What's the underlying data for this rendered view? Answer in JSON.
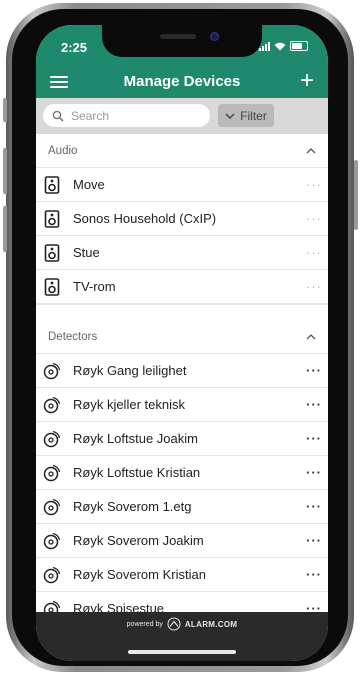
{
  "status_bar": {
    "time": "2:25"
  },
  "app_bar": {
    "title": "Manage Devices",
    "menu_icon": "hamburger-menu-icon",
    "add_icon": "plus-icon"
  },
  "search": {
    "placeholder": "Search",
    "filter_label": "Filter"
  },
  "sections": [
    {
      "title": "Audio",
      "icon": "speaker-icon",
      "items": [
        "Move",
        "Sonos Household (CxIP)",
        "Stue",
        "TV-rom"
      ]
    },
    {
      "title": "Detectors",
      "icon": "smoke-detector-icon",
      "items": [
        "Røyk Gang leilighet",
        "Røyk kjeller teknisk",
        "Røyk Loftstue Joakim",
        "Røyk Loftstue Kristian",
        "Røyk Soverom 1.etg",
        "Røyk Soverom Joakim",
        "Røyk Soverom Kristian",
        "Røyk Spisestue"
      ]
    }
  ],
  "footer": {
    "powered_by": "powered by",
    "brand": "ALARM.COM"
  },
  "colors": {
    "header": "#1f8a6b",
    "footer": "#2a2a2a"
  }
}
